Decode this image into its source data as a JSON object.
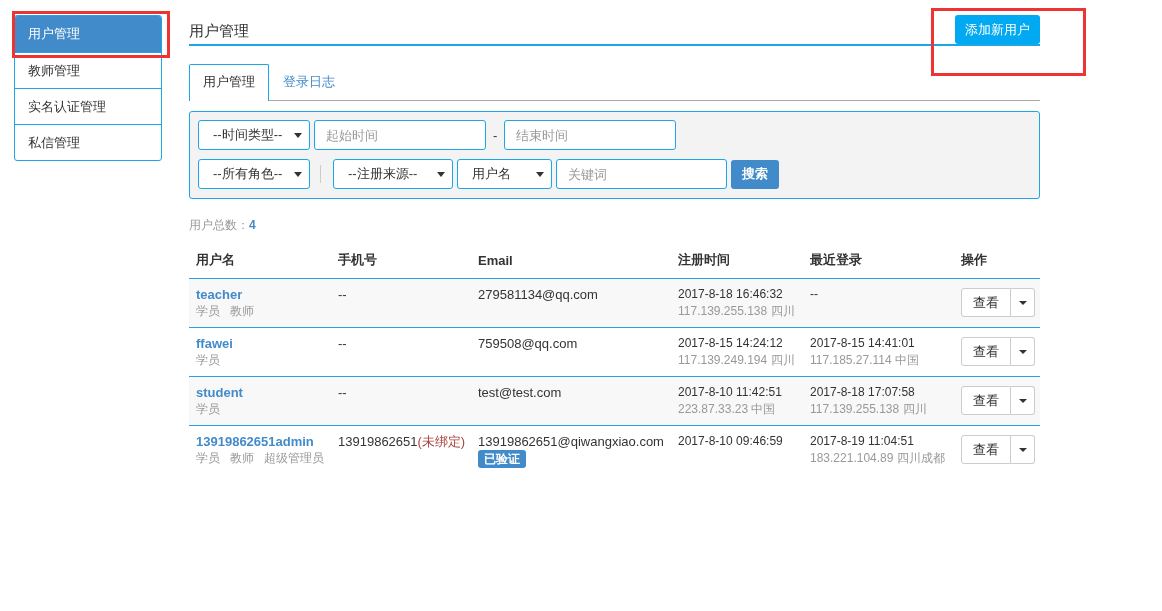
{
  "sidebar": {
    "items": [
      {
        "label": "用户管理",
        "selected": true
      },
      {
        "label": "教师管理",
        "selected": false
      },
      {
        "label": "实名认证管理",
        "selected": false
      },
      {
        "label": "私信管理",
        "selected": false
      }
    ]
  },
  "page_title": "用户管理",
  "add_button": "添加新用户",
  "tabs": [
    {
      "label": "用户管理",
      "selected": true
    },
    {
      "label": "登录日志",
      "selected": false
    }
  ],
  "filters": {
    "time_type": "--时间类型--",
    "start_placeholder": "起始时间",
    "separator": "-",
    "end_placeholder": "结束时间",
    "role": "--所有角色--",
    "source": "--注册来源--",
    "field": "用户名",
    "keyword_placeholder": "关键词",
    "search_button": "搜索"
  },
  "total": {
    "label": "用户总数：",
    "value": "4"
  },
  "table": {
    "columns": [
      "用户名",
      "手机号",
      "Email",
      "注册时间",
      "最近登录",
      "操作"
    ],
    "rows": [
      {
        "username": "teacher",
        "roles": [
          "学员",
          "教师"
        ],
        "phone": "--",
        "email": "279581134@qq.com",
        "registered": "2017-8-18 16:46:32",
        "registered_ip": "117.139.255.138 四川",
        "last_login": "--",
        "action": "查看"
      },
      {
        "username": "ffawei",
        "roles": [
          "学员"
        ],
        "phone": "--",
        "email": "759508@qq.com",
        "registered": "2017-8-15 14:24:12",
        "registered_ip": "117.139.249.194 四川",
        "last_login": "2017-8-15 14:41:01",
        "last_login_ip": "117.185.27.114 中国",
        "action": "查看"
      },
      {
        "username": "student",
        "roles": [
          "学员"
        ],
        "phone": "--",
        "email": "test@test.com",
        "registered": "2017-8-10 11:42:51",
        "registered_ip": "223.87.33.23 中国",
        "last_login": "2017-8-18 17:07:58",
        "last_login_ip": "117.139.255.138 四川",
        "action": "查看"
      },
      {
        "username": "13919862651admin",
        "roles": [
          "学员",
          "教师",
          "超级管理员"
        ],
        "phone": "13919862651",
        "phone_note": "(未绑定)",
        "email": "13919862651@qiwangxiao.com",
        "email_badge": "已验证",
        "registered": "2017-8-10 09:46:59",
        "last_login": "2017-8-19 11:04:51",
        "last_login_ip": "183.221.104.89 四川成都",
        "action": "查看"
      }
    ]
  }
}
